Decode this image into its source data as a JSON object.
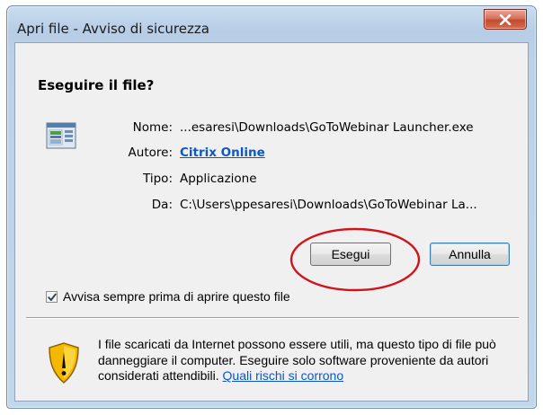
{
  "window": {
    "title": "Apri file - Avviso di sicurezza"
  },
  "heading": "Eseguire il file?",
  "file_info": {
    "name_label": "Nome:",
    "name_value": "...esaresi\\Downloads\\GoToWebinar Launcher.exe",
    "author_label": "Autore:",
    "author_value": "Citrix Online",
    "type_label": "Tipo:",
    "type_value": "Applicazione",
    "from_label": "Da:",
    "from_value": "C:\\Users\\ppesaresi\\Downloads\\GoToWebinar La..."
  },
  "buttons": {
    "run_label": "Esegui",
    "cancel_label": "Annulla"
  },
  "checkbox": {
    "label": "Avvisa sempre prima di aprire questo file",
    "checked": true
  },
  "warning": {
    "text": "I file scaricati da Internet possono essere utili, ma questo tipo di file può danneggiare il computer. Eseguire solo software proveniente da autori considerati attendibili.",
    "link_text": "Quali rischi si corrono"
  },
  "icons": {
    "file": "application-file-icon",
    "shield": "security-warning-shield-icon",
    "close": "close-icon",
    "check": "check-icon"
  },
  "colors": {
    "link": "#0b57c9",
    "close_button": "#c24b30",
    "highlight_circle": "#d1141b"
  }
}
